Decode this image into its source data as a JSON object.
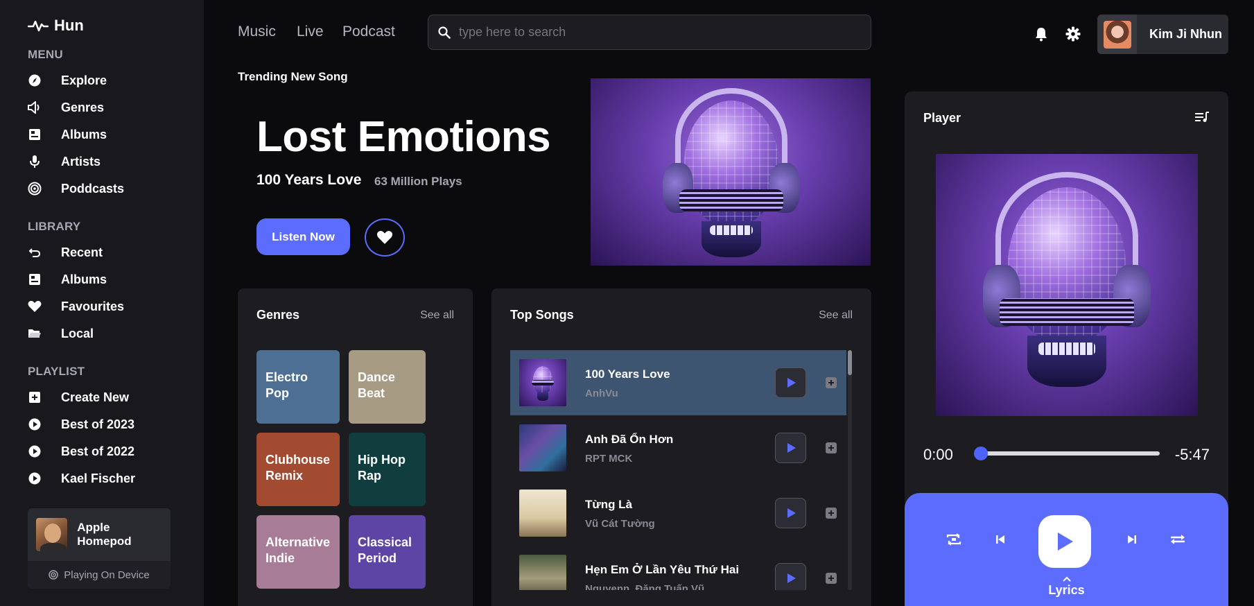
{
  "brand": {
    "name": "Hun"
  },
  "menu": {
    "label": "MENU",
    "items": [
      {
        "label": "Explore",
        "icon": "compass-icon"
      },
      {
        "label": "Genres",
        "icon": "speaker-icon"
      },
      {
        "label": "Albums",
        "icon": "album-icon"
      },
      {
        "label": "Artists",
        "icon": "microphone-icon"
      },
      {
        "label": "Poddcasts",
        "icon": "podcast-icon"
      }
    ]
  },
  "library": {
    "label": "LIBRARY",
    "items": [
      {
        "label": "Recent",
        "icon": "undo-icon"
      },
      {
        "label": "Albums",
        "icon": "album-icon"
      },
      {
        "label": "Favourites",
        "icon": "heart-icon"
      },
      {
        "label": "Local",
        "icon": "folder-icon"
      }
    ]
  },
  "playlist": {
    "label": "PLAYLIST",
    "items": [
      {
        "label": "Create New",
        "icon": "plus-square-icon"
      },
      {
        "label": "Best of 2023",
        "icon": "play-circle-icon"
      },
      {
        "label": "Best of 2022",
        "icon": "play-circle-icon"
      },
      {
        "label": "Kael Fischer",
        "icon": "play-circle-icon"
      }
    ]
  },
  "device": {
    "name": "Apple Homepod",
    "status": "Playing On Device"
  },
  "topnav": {
    "music": "Music",
    "live": "Live",
    "podcast": "Podcast"
  },
  "search": {
    "placeholder": "type here to search",
    "value": ""
  },
  "user": {
    "name": "Kim Ji Nhun"
  },
  "hero": {
    "label": "Trending New Song",
    "title": "Lost Emotions",
    "subtitle": "100 Years Love",
    "plays": "63 Million Plays",
    "listen_label": "Listen Now"
  },
  "genres": {
    "title": "Genres",
    "see_all": "See all",
    "tiles": [
      {
        "label": "Electro Pop",
        "color": "#4d6f93"
      },
      {
        "label": "Dance Beat",
        "color": "#a89b84"
      },
      {
        "label": "Clubhouse Remix",
        "color": "#a24b30"
      },
      {
        "label": "Hip Hop Rap",
        "color": "#103d3e"
      },
      {
        "label": "Alternative Indie",
        "color": "#a77c96"
      },
      {
        "label": "Classical Period",
        "color": "#5d45a6"
      }
    ]
  },
  "top_songs": {
    "title": "Top Songs",
    "see_all": "See all",
    "songs": [
      {
        "title": "100 Years Love",
        "artist": "AnhVu"
      },
      {
        "title": "Anh Đã Ổn Hơn",
        "artist": "RPT MCK"
      },
      {
        "title": "Từng Là",
        "artist": "Vũ Cát Tường"
      },
      {
        "title": "Hẹn Em Ở Lần Yêu Thứ Hai",
        "artist": "Nguyenn, Đặng Tuấn Vũ"
      }
    ]
  },
  "player": {
    "title": "Player",
    "current_time": "0:00",
    "remaining_time": "-5:47",
    "progress": 0,
    "lyrics_label": "Lyrics"
  },
  "colors": {
    "accent": "#5b6cff",
    "background": "#0b0b0e",
    "panel": "#1c1c21",
    "active_row": "#3e5572"
  }
}
